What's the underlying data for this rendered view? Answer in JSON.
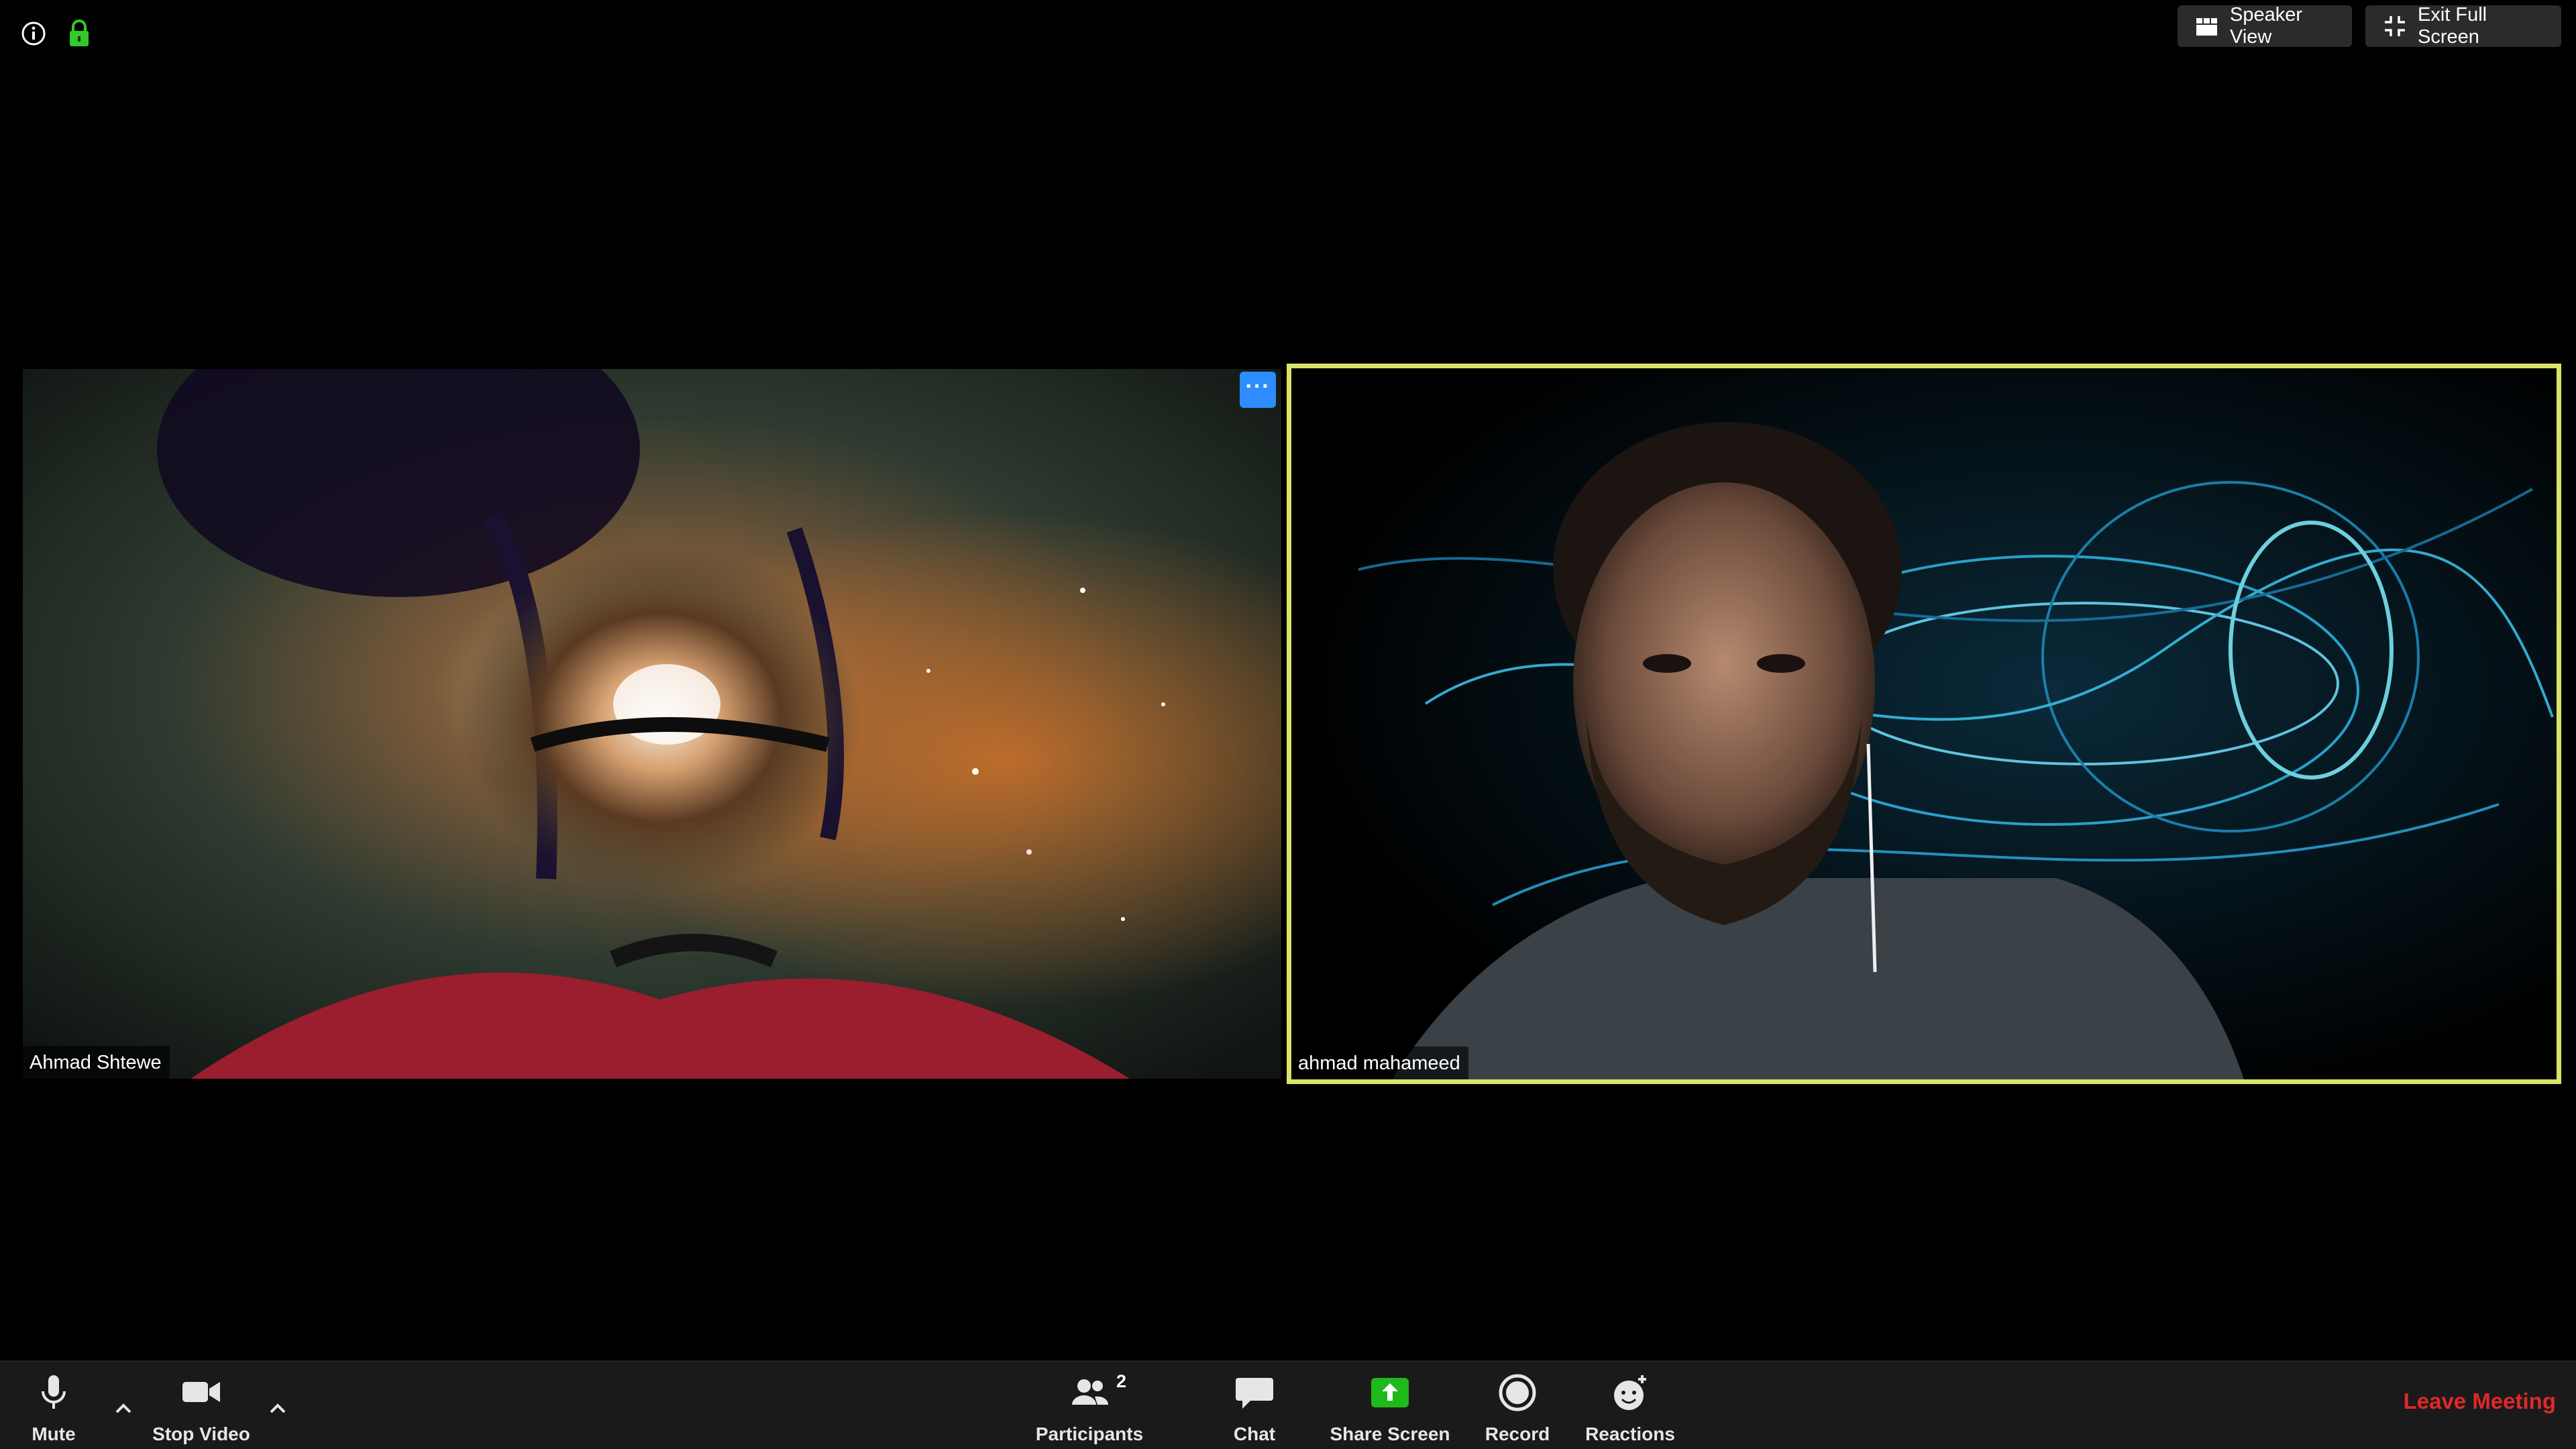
{
  "top_bar": {
    "speaker_view_label": "Speaker View",
    "exit_full_screen_label": "Exit Full Screen"
  },
  "participants": [
    {
      "name": "Ahmad Shtewe",
      "active_speaker": false
    },
    {
      "name": "ahmad mahameed",
      "active_speaker": true
    }
  ],
  "tile_menu_label": "···",
  "toolbar": {
    "mute_label": "Mute",
    "stop_video_label": "Stop Video",
    "participants_label": "Participants",
    "participants_count": "2",
    "chat_label": "Chat",
    "share_screen_label": "Share Screen",
    "record_label": "Record",
    "reactions_label": "Reactions",
    "leave_label": "Leave Meeting"
  },
  "colors": {
    "active_speaker_border": "#d9e36a",
    "share_screen_green": "#1fb91a",
    "leave_red": "#e02828",
    "lock_green": "#34c92a",
    "menu_blue": "#2d8cff"
  }
}
